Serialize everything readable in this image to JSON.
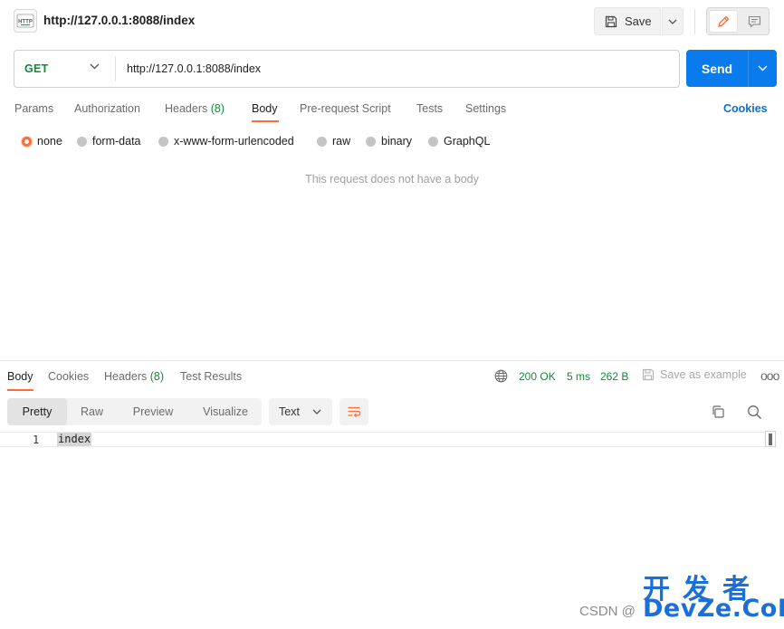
{
  "header": {
    "icon_text": "HTTP",
    "title": "http://127.0.0.1:8088/index",
    "save_label": "Save"
  },
  "request": {
    "method": "GET",
    "url": "http://127.0.0.1:8088/index",
    "send_label": "Send",
    "tabs": [
      {
        "label": "Params"
      },
      {
        "label": "Authorization"
      },
      {
        "label": "Headers",
        "count": "(8)"
      },
      {
        "label": "Body"
      },
      {
        "label": "Pre-request Script"
      },
      {
        "label": "Tests"
      },
      {
        "label": "Settings"
      }
    ],
    "active_tab": "Body",
    "cookies_label": "Cookies",
    "body_types": [
      "none",
      "form-data",
      "x-www-form-urlencoded",
      "raw",
      "binary",
      "GraphQL"
    ],
    "selected_body_type": "none",
    "empty_message": "This request does not have a body"
  },
  "response": {
    "tabs": [
      {
        "label": "Body"
      },
      {
        "label": "Cookies"
      },
      {
        "label": "Headers",
        "count": "(8)"
      },
      {
        "label": "Test Results"
      }
    ],
    "active_tab": "Body",
    "status": "200 OK",
    "time": "5 ms",
    "size": "262 B",
    "save_example_label": "Save as example",
    "more_label": "ooo",
    "view_modes": [
      "Pretty",
      "Raw",
      "Preview",
      "Visualize"
    ],
    "active_view": "Pretty",
    "format": "Text",
    "lines": [
      {
        "number": "1",
        "text": "index"
      }
    ]
  },
  "watermark": {
    "cn": "开发者",
    "csdn": "CSDN @",
    "en": "DevZe.CoM"
  },
  "colors": {
    "accent": "#ff6c37",
    "send": "#097bed",
    "method_get": "#0f8a3a",
    "link": "#0b6fd1",
    "watermark": "#1d6fd8"
  }
}
